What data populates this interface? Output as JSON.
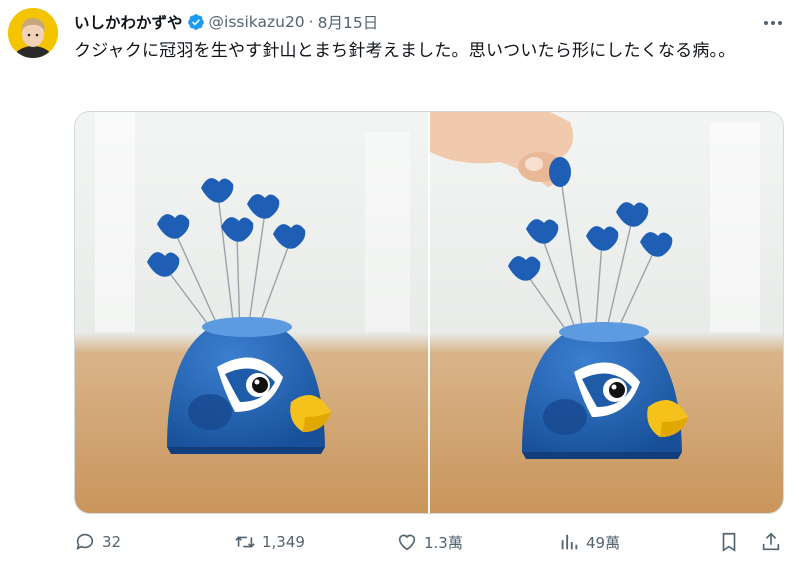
{
  "tweet": {
    "author_name": "いしかわかずや",
    "handle": "@issikazu20",
    "separator": "·",
    "date": "8月15日",
    "text": "クジャクに冠羽を生やす針山とまち針考えました。思いついたら形にしたくなる病。。"
  },
  "actions": {
    "reply_count": "32",
    "retweet_count": "1,349",
    "like_count": "1.3萬",
    "view_count": "49萬"
  },
  "icons": {
    "verified": "verified-badge-icon",
    "more": "more-options-icon",
    "reply": "reply-icon",
    "retweet": "retweet-icon",
    "like": "heart-icon",
    "views": "analytics-icon",
    "bookmark": "bookmark-icon",
    "share": "share-icon"
  },
  "colors": {
    "verified_blue": "#1d9bf0",
    "secondary_text": "#536471",
    "pincushion_blue": "#1f5ca8",
    "beak_yellow": "#f5c21b"
  }
}
